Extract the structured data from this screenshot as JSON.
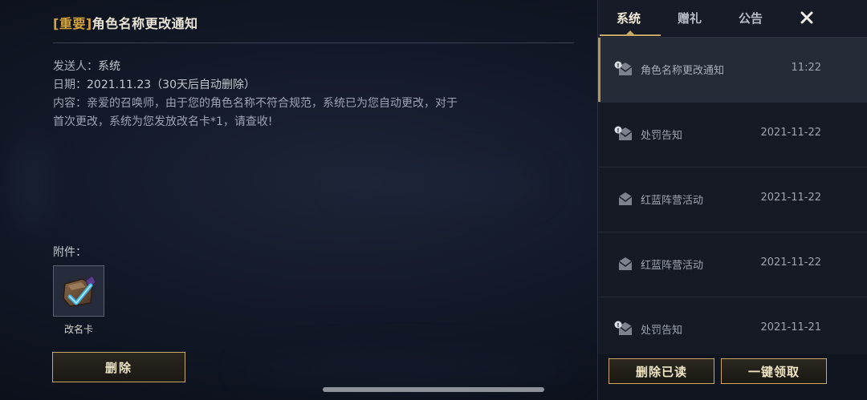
{
  "mail": {
    "title_tag": "[重要]",
    "title": "角色名称更改通知",
    "sender_label": "发送人：",
    "sender": "系统",
    "date_label": "日期：",
    "date": "2021.11.23（30天后自动删除）",
    "content_label": "内容：",
    "content": "亲爱的召唤师，由于您的角色名称不符合规范，系统已为您自动更改，对于首次更改，系统为您发放改名卡*1，请查收!",
    "attachments_label": "附件：",
    "attachment": {
      "name": "改名卡",
      "icon": "rename-card-icon"
    },
    "delete_button": "删除"
  },
  "panel": {
    "tabs": [
      {
        "label": "系统",
        "active": true
      },
      {
        "label": "赠礼",
        "active": false
      },
      {
        "label": "公告",
        "active": false
      }
    ],
    "close_icon": "close-icon",
    "items": [
      {
        "subject": "角色名称更改通知",
        "date": "11:22",
        "icon": "mail-read-alert-icon",
        "selected": true
      },
      {
        "subject": "处罚告知",
        "date": "2021-11-22",
        "icon": "mail-read-alert-icon",
        "selected": false
      },
      {
        "subject": "红蓝阵营活动",
        "date": "2021-11-22",
        "icon": "mail-read-icon",
        "selected": false
      },
      {
        "subject": "红蓝阵营活动",
        "date": "2021-11-22",
        "icon": "mail-read-icon",
        "selected": false
      },
      {
        "subject": "处罚告知",
        "date": "2021-11-21",
        "icon": "mail-read-alert-icon",
        "selected": false
      }
    ],
    "delete_read_button": "删除已读",
    "claim_all_button": "一键领取"
  },
  "colors": {
    "accent_gold": "#c8a865",
    "tag_gold": "#d4a33c",
    "panel_bg": "#121722"
  }
}
